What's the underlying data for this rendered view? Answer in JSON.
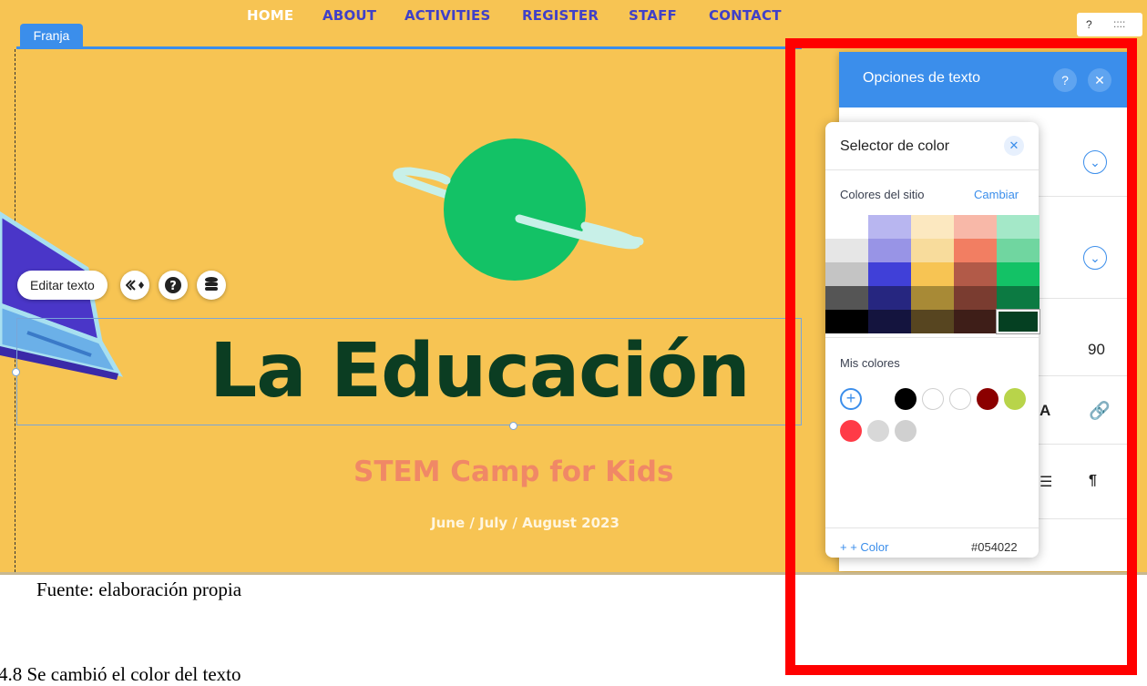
{
  "nav": {
    "items": [
      "HOME",
      "ABOUT",
      "ACTIVITIES",
      "REGISTER",
      "STAFF",
      "CONTACT"
    ]
  },
  "editor": {
    "strip_label": "Franja",
    "edit_text_label": "Editar texto",
    "top_right": {
      "help": "?",
      "grip": "::::"
    }
  },
  "hero": {
    "heading": "La Educación",
    "subheading": "STEM Camp for Kids",
    "dates": "June / July / August 2023"
  },
  "text_panel": {
    "title": "Opciones de texto",
    "help": "?",
    "close": "✕",
    "letter_spacing_value": "90"
  },
  "color_picker": {
    "title": "Selector de color",
    "close": "✕",
    "site_colors_label": "Colores del sitio",
    "change_label": "Cambiar",
    "site_colors": [
      [
        "#FFFFFF",
        "#B8B6F0",
        "#FCE8C0",
        "#F8B8A8",
        "#A4E8C8"
      ],
      [
        "#E6E6E6",
        "#9894E6",
        "#F8DC9C",
        "#F27E62",
        "#70D6A0"
      ],
      [
        "#C4C4C4",
        "#4040D8",
        "#F7C453",
        "#B25A48",
        "#13C266"
      ],
      [
        "#555555",
        "#262680",
        "#A88A36",
        "#7A3C30",
        "#0C7A42"
      ],
      [
        "#000000",
        "#14143E",
        "#574520",
        "#3E1E18",
        "#054022"
      ]
    ],
    "selected_swatch": "#054022",
    "my_colors_label": "Mis colores",
    "my_colors": [
      "#000000",
      "#FFFFFF",
      "#FFFFFF",
      "#8B0000",
      "#B8D44A",
      "#FF3B47",
      "#D8D8D8",
      "#D0D0D0"
    ],
    "add_color_label": "+ + Color",
    "hex_value": "#054022"
  },
  "captions": {
    "source": "Fuente: elaboración propia",
    "section": "4.8 Se cambió el color del texto"
  },
  "colors": {
    "stage_bg": "#F7C453",
    "accent_blue": "#3B8EEB",
    "heading": "#0B3D22",
    "subheading": "#F08866",
    "highlight_frame": "#FF0000"
  }
}
